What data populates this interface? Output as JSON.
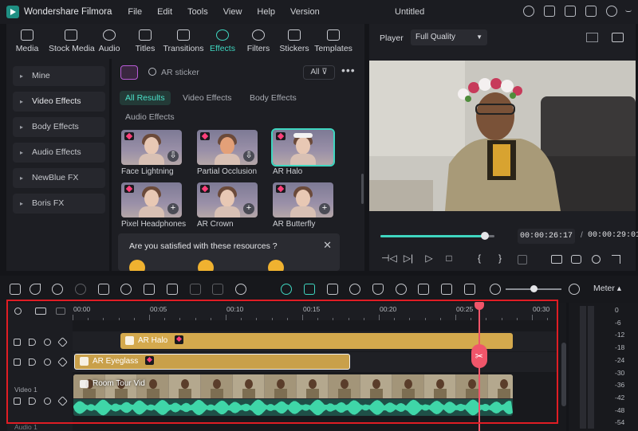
{
  "app": {
    "name": "Wondershare Filmora",
    "doc_title": "Untitled"
  },
  "menu": [
    "File",
    "Edit",
    "Tools",
    "View",
    "Help",
    "Version"
  ],
  "media_tabs": [
    "Media",
    "Stock Media",
    "Audio",
    "Titles",
    "Transitions",
    "Effects",
    "Filters",
    "Stickers",
    "Templates"
  ],
  "media_active": "Effects",
  "categories": [
    "Mine",
    "Video Effects",
    "Body Effects",
    "Audio Effects",
    "NewBlue FX",
    "Boris FX"
  ],
  "search": {
    "placeholder": "AR sticker",
    "filter_label": "All ⊽"
  },
  "filter_tabs": [
    "All Results",
    "Video Effects",
    "Body Effects",
    "Audio Effects"
  ],
  "effects": [
    {
      "label": "Face Lightning",
      "badge": "⇩",
      "selected": false
    },
    {
      "label": "Partial Occlusion",
      "badge": "⇩",
      "selected": false
    },
    {
      "label": "AR Halo",
      "badge": "",
      "selected": true
    },
    {
      "label": "Pixel Headphones",
      "badge": "+",
      "selected": false
    },
    {
      "label": "AR Crown",
      "badge": "+",
      "selected": false
    },
    {
      "label": "AR Butterfly",
      "badge": "+",
      "selected": false
    }
  ],
  "survey": {
    "question": "Are you satisfied with these resources ?",
    "close": "✕"
  },
  "player": {
    "label": "Player",
    "quality": "Full Quality",
    "current_time": "00:00:26:17",
    "separator": "/",
    "total_time": "00:00:29:01",
    "progress": 0.913,
    "controls": [
      "⊣◁",
      "▷|",
      "▷",
      "□",
      "{",
      "}"
    ]
  },
  "timeline": {
    "ruler_labels": [
      "00:00",
      "00:05",
      "00:10",
      "00:15",
      "00:20",
      "00:25",
      "00:30"
    ],
    "clips": {
      "halo": "AR Halo",
      "eyeglass": "AR Eyeglass",
      "video": "Room Tour Vid"
    },
    "track_labels": {
      "video": "Video 1",
      "audio": "Audio 1"
    },
    "playhead_seconds": 26.5
  },
  "meter": {
    "label": "Meter ▴",
    "scale": [
      "0",
      "-6",
      "-12",
      "-18",
      "-24",
      "-30",
      "-36",
      "-42",
      "-48",
      "-54"
    ]
  },
  "colors": {
    "accent": "#3fd6c0",
    "playhead": "#f0556a",
    "effect_clip": "#d4a94d",
    "highlight": "#e01d24"
  }
}
